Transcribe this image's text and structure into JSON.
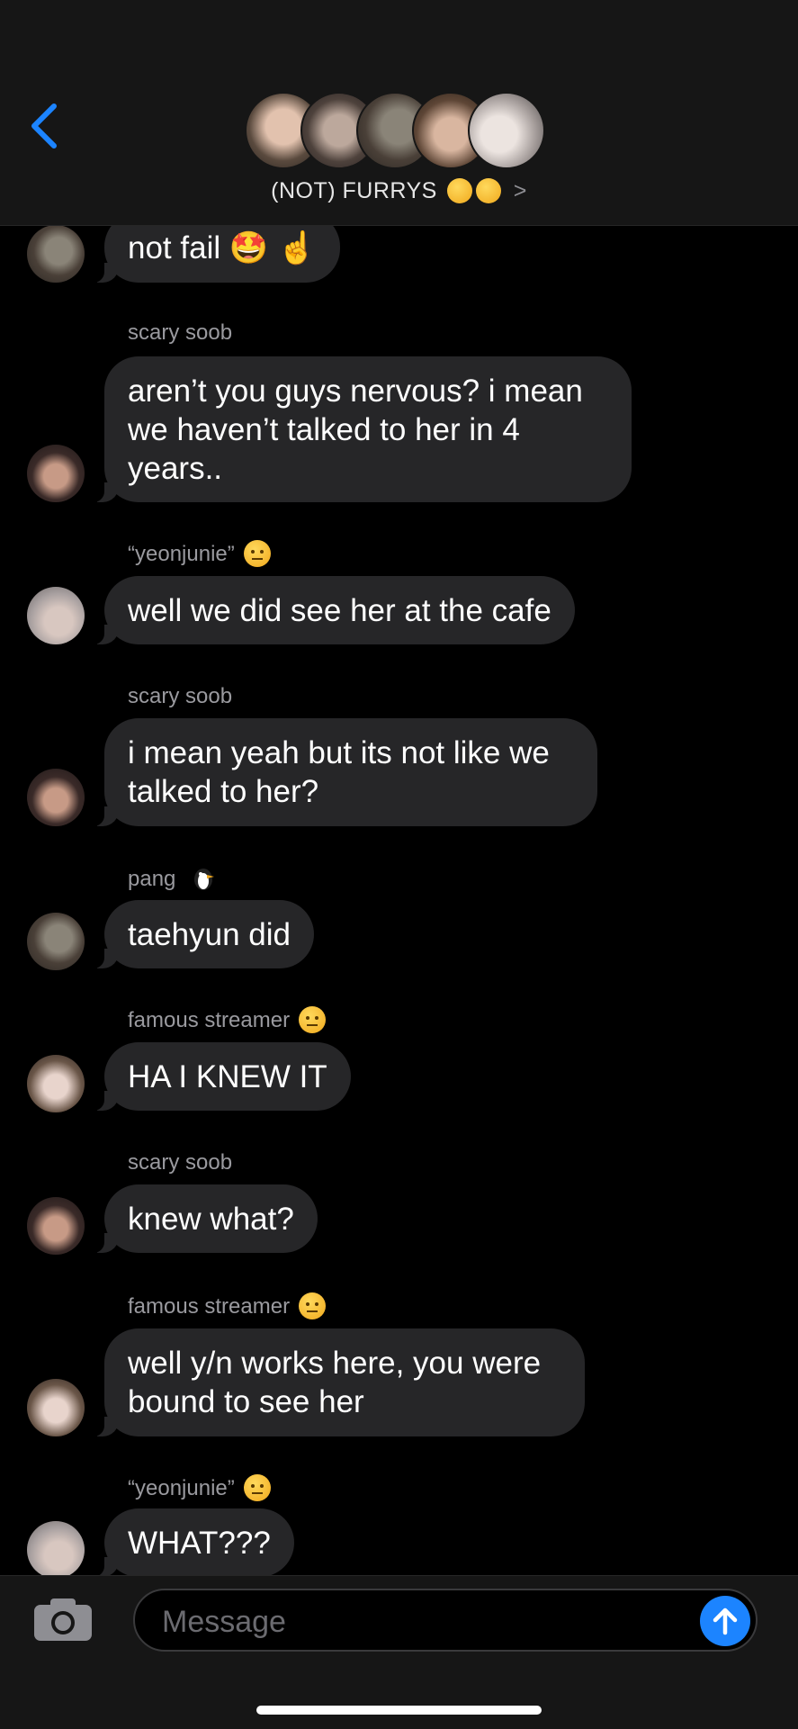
{
  "header": {
    "group_name": "(NOT) FURRYS",
    "group_emojis": [
      "😣",
      "😣"
    ],
    "chevron": ">",
    "participants": [
      "member-1",
      "member-2",
      "member-3",
      "member-4",
      "member-5"
    ]
  },
  "messages": [
    {
      "sender": "",
      "sender_emoji": "",
      "text": "not fail 🤩 ☝️",
      "avatar": "pang"
    },
    {
      "sender": "scary soob",
      "sender_emoji": "",
      "text": "aren’t you guys nervous? i mean we haven’t talked to her in 4 years..",
      "avatar": "soob"
    },
    {
      "sender": "“yeonjunie”",
      "sender_emoji": "🤨",
      "text": "well we did see her at the cafe",
      "avatar": "yeon"
    },
    {
      "sender": "scary soob",
      "sender_emoji": "",
      "text": "i mean yeah but its not like we talked to her?",
      "avatar": "soob"
    },
    {
      "sender": "pang",
      "sender_emoji": "🐧",
      "text": "taehyun did",
      "avatar": "pang"
    },
    {
      "sender": "famous streamer",
      "sender_emoji": "🤨",
      "text": "HA I KNEW IT",
      "avatar": "famous"
    },
    {
      "sender": "scary soob",
      "sender_emoji": "",
      "text": "knew what?",
      "avatar": "soob"
    },
    {
      "sender": "famous streamer",
      "sender_emoji": "🤨",
      "text": "well y/n works here, you were bound to see her",
      "avatar": "famous"
    },
    {
      "sender": "“yeonjunie”",
      "sender_emoji": "🤨",
      "text": "WHAT???",
      "avatar": "yeon"
    }
  ],
  "composer": {
    "placeholder": "Message"
  },
  "colors": {
    "accent": "#1c84ff",
    "bubble": "#262628",
    "background": "#000000"
  }
}
